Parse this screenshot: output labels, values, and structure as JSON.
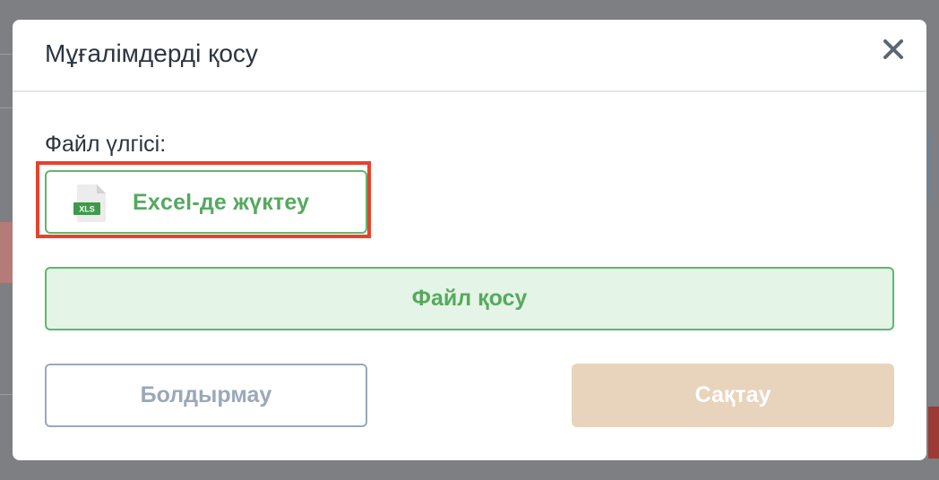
{
  "modal": {
    "title": "Мұғалімдерді қосу",
    "close_icon": "close-icon",
    "template_label": "Файл үлгісі:",
    "download_button": {
      "icon": "xls-file-icon",
      "icon_text": "XLS",
      "label": "Excel-де жүктеу"
    },
    "add_file_button": {
      "label": "Файл қосу"
    },
    "cancel_button": {
      "label": "Болдырмау"
    },
    "save_button": {
      "label": "Сақтау"
    }
  },
  "colors": {
    "accent_green": "#55a95f",
    "highlight_red": "#e8412c",
    "save_disabled": "#e8d3bc",
    "cancel_border": "#9aa8ba"
  }
}
